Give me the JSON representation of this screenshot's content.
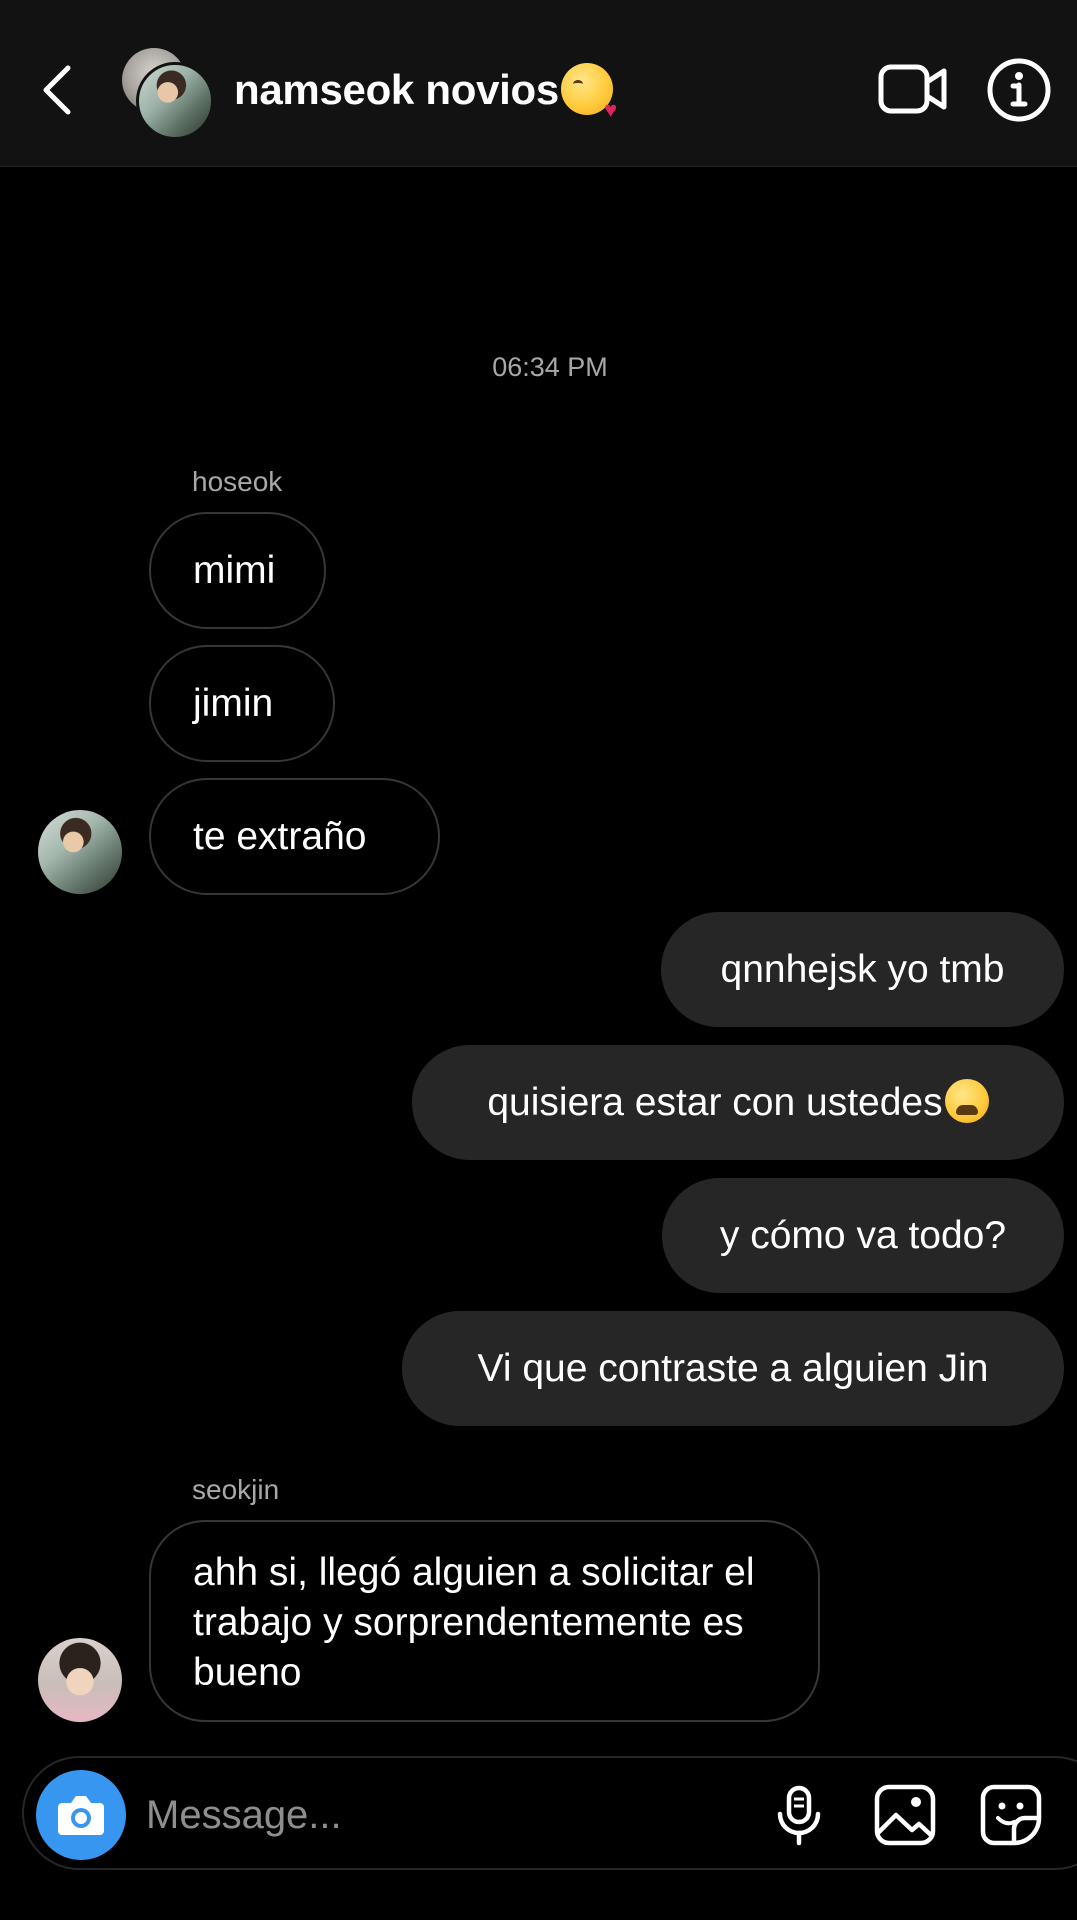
{
  "header": {
    "title": "namseok novios",
    "title_emoji": "kissing-face-heart-emoji"
  },
  "conversation": {
    "timestamp": "06:34 PM",
    "groups": [
      {
        "sender": "hoseok",
        "direction": "incoming",
        "messages": [
          "mimi",
          "jimin",
          "te extraño"
        ]
      },
      {
        "sender": "me",
        "direction": "outgoing",
        "messages": [
          "qnnhejsk yo tmb",
          "quisiera estar con ustedes",
          "y cómo va todo?",
          "Vi que contraste a alguien Jin"
        ]
      },
      {
        "sender": "seokjin",
        "direction": "incoming",
        "messages": [
          "ahh si, llegó alguien a solicitar el trabajo y sorprendentemente es bueno"
        ]
      }
    ]
  },
  "composer": {
    "placeholder": "Message..."
  },
  "icons": {
    "back": "chevron-left-icon",
    "video": "video-call-icon",
    "info": "info-icon",
    "camera": "camera-icon",
    "mic": "microphone-icon",
    "gallery": "gallery-icon",
    "sticker": "sticker-icon"
  },
  "colors": {
    "background": "#000000",
    "header_bg": "#121212",
    "outgoing_bubble": "#262626",
    "incoming_border": "#363636",
    "camera_button": "#3797f0",
    "secondary_text": "#a8a8a8"
  }
}
